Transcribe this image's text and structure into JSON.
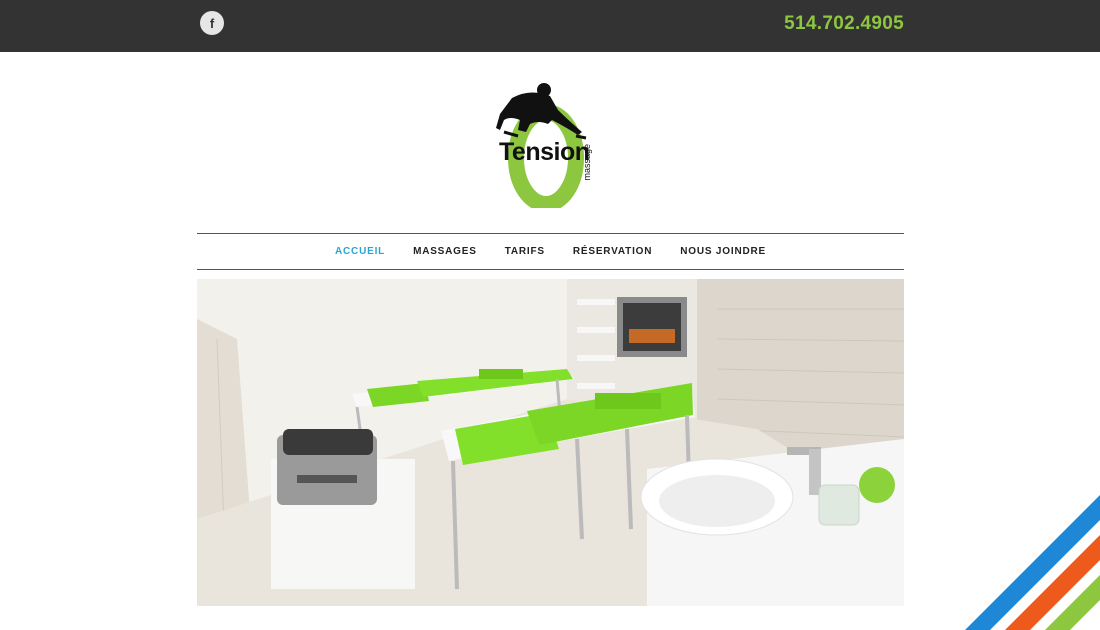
{
  "header": {
    "social_icon": "facebook-icon",
    "social_glyph": "f",
    "phone": "514.702.4905"
  },
  "logo": {
    "word": "Tension",
    "sub": "massage",
    "accent": "#8dc63f"
  },
  "nav": {
    "items": [
      {
        "label": "ACCUEIL",
        "active": true
      },
      {
        "label": "MASSAGES",
        "active": false
      },
      {
        "label": "TARIFS",
        "active": false
      },
      {
        "label": "RÉSERVATION",
        "active": false
      },
      {
        "label": "NOUS JOINDRE",
        "active": false
      }
    ]
  },
  "hero": {
    "subject": "massage room with two tables and green towels"
  },
  "colors": {
    "topbar": "#333333",
    "phone": "#8dc63f",
    "nav_active": "#2aa6d5",
    "stripe_blue": "#1e88d6",
    "stripe_orange": "#ee5a1b",
    "stripe_green": "#8dc63f"
  }
}
